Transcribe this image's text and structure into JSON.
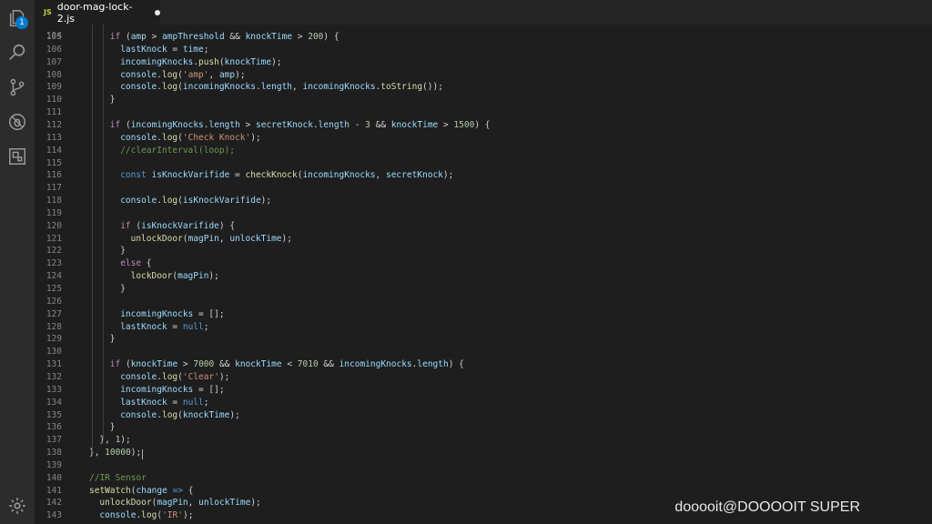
{
  "tab": {
    "icon": "JS",
    "filename": "door-mag-lock-2.js",
    "dirty": true
  },
  "activity": {
    "explorer_badge": "1"
  },
  "watermark": "dooooit@DOOOOIT SUPER",
  "code": {
    "partial_top": "104",
    "lines": [
      {
        "n": "105",
        "i": 2,
        "t": [
          [
            "cf",
            "if"
          ],
          [
            "p",
            " ("
          ],
          [
            "v",
            "amp"
          ],
          [
            "p",
            " > "
          ],
          [
            "v",
            "ampThreshold"
          ],
          [
            "p",
            " && "
          ],
          [
            "v",
            "knockTime"
          ],
          [
            "p",
            " > "
          ],
          [
            "n",
            "200"
          ],
          [
            "p",
            ") {"
          ]
        ]
      },
      {
        "n": "106",
        "i": 3,
        "t": [
          [
            "v",
            "lastKnock"
          ],
          [
            "p",
            " = "
          ],
          [
            "v",
            "time"
          ],
          [
            "p",
            ";"
          ]
        ]
      },
      {
        "n": "107",
        "i": 3,
        "t": [
          [
            "v",
            "incomingKnocks"
          ],
          [
            "p",
            "."
          ],
          [
            "f",
            "push"
          ],
          [
            "p",
            "("
          ],
          [
            "v",
            "knockTime"
          ],
          [
            "p",
            ");"
          ]
        ]
      },
      {
        "n": "108",
        "i": 3,
        "t": [
          [
            "v",
            "console"
          ],
          [
            "p",
            "."
          ],
          [
            "f",
            "log"
          ],
          [
            "p",
            "("
          ],
          [
            "s",
            "'amp'"
          ],
          [
            "p",
            ", "
          ],
          [
            "v",
            "amp"
          ],
          [
            "p",
            ");"
          ]
        ]
      },
      {
        "n": "109",
        "i": 3,
        "t": [
          [
            "v",
            "console"
          ],
          [
            "p",
            "."
          ],
          [
            "f",
            "log"
          ],
          [
            "p",
            "("
          ],
          [
            "v",
            "incomingKnocks"
          ],
          [
            "p",
            "."
          ],
          [
            "v",
            "length"
          ],
          [
            "p",
            ", "
          ],
          [
            "v",
            "incomingKnocks"
          ],
          [
            "p",
            "."
          ],
          [
            "f",
            "toString"
          ],
          [
            "p",
            "());"
          ]
        ]
      },
      {
        "n": "110",
        "i": 2,
        "t": [
          [
            "p",
            "}"
          ]
        ]
      },
      {
        "n": "111",
        "i": 0,
        "t": []
      },
      {
        "n": "112",
        "i": 2,
        "t": [
          [
            "cf",
            "if"
          ],
          [
            "p",
            " ("
          ],
          [
            "v",
            "incomingKnocks"
          ],
          [
            "p",
            "."
          ],
          [
            "v",
            "length"
          ],
          [
            "p",
            " > "
          ],
          [
            "v",
            "secretKnock"
          ],
          [
            "p",
            "."
          ],
          [
            "v",
            "length"
          ],
          [
            "p",
            " - "
          ],
          [
            "n",
            "3"
          ],
          [
            "p",
            " && "
          ],
          [
            "v",
            "knockTime"
          ],
          [
            "p",
            " > "
          ],
          [
            "n",
            "1500"
          ],
          [
            "p",
            ") {"
          ]
        ]
      },
      {
        "n": "113",
        "i": 3,
        "t": [
          [
            "v",
            "console"
          ],
          [
            "p",
            "."
          ],
          [
            "f",
            "log"
          ],
          [
            "p",
            "("
          ],
          [
            "s",
            "'Check Knock'"
          ],
          [
            "p",
            ");"
          ]
        ]
      },
      {
        "n": "114",
        "i": 3,
        "t": [
          [
            "c",
            "//clearInterval(loop);"
          ]
        ]
      },
      {
        "n": "115",
        "i": 0,
        "t": []
      },
      {
        "n": "116",
        "i": 3,
        "t": [
          [
            "k",
            "const"
          ],
          [
            "p",
            " "
          ],
          [
            "v",
            "isKnockVarifide"
          ],
          [
            "p",
            " = "
          ],
          [
            "f",
            "checkKnock"
          ],
          [
            "p",
            "("
          ],
          [
            "v",
            "incomingKnocks"
          ],
          [
            "p",
            ", "
          ],
          [
            "v",
            "secretKnock"
          ],
          [
            "p",
            ");"
          ]
        ]
      },
      {
        "n": "117",
        "i": 0,
        "t": []
      },
      {
        "n": "118",
        "i": 3,
        "t": [
          [
            "v",
            "console"
          ],
          [
            "p",
            "."
          ],
          [
            "f",
            "log"
          ],
          [
            "p",
            "("
          ],
          [
            "v",
            "isKnockVarifide"
          ],
          [
            "p",
            ");"
          ]
        ]
      },
      {
        "n": "119",
        "i": 0,
        "t": []
      },
      {
        "n": "120",
        "i": 3,
        "t": [
          [
            "cf",
            "if"
          ],
          [
            "p",
            " ("
          ],
          [
            "v",
            "isKnockVarifide"
          ],
          [
            "p",
            ") {"
          ]
        ]
      },
      {
        "n": "121",
        "i": 4,
        "t": [
          [
            "f",
            "unlockDoor"
          ],
          [
            "p",
            "("
          ],
          [
            "v",
            "magPin"
          ],
          [
            "p",
            ", "
          ],
          [
            "v",
            "unlockTime"
          ],
          [
            "p",
            ");"
          ]
        ]
      },
      {
        "n": "122",
        "i": 3,
        "t": [
          [
            "p",
            "}"
          ]
        ]
      },
      {
        "n": "123",
        "i": 3,
        "t": [
          [
            "cf",
            "else"
          ],
          [
            "p",
            " {"
          ]
        ]
      },
      {
        "n": "124",
        "i": 4,
        "t": [
          [
            "f",
            "lockDoor"
          ],
          [
            "p",
            "("
          ],
          [
            "v",
            "magPin"
          ],
          [
            "p",
            ");"
          ]
        ]
      },
      {
        "n": "125",
        "i": 3,
        "t": [
          [
            "p",
            "}"
          ]
        ]
      },
      {
        "n": "126",
        "i": 0,
        "t": []
      },
      {
        "n": "127",
        "i": 3,
        "t": [
          [
            "v",
            "incomingKnocks"
          ],
          [
            "p",
            " = [];"
          ]
        ]
      },
      {
        "n": "128",
        "i": 3,
        "t": [
          [
            "v",
            "lastKnock"
          ],
          [
            "p",
            " = "
          ],
          [
            "k",
            "null"
          ],
          [
            "p",
            ";"
          ]
        ]
      },
      {
        "n": "129",
        "i": 2,
        "t": [
          [
            "p",
            "}"
          ]
        ]
      },
      {
        "n": "130",
        "i": 0,
        "t": []
      },
      {
        "n": "131",
        "i": 2,
        "t": [
          [
            "cf",
            "if"
          ],
          [
            "p",
            " ("
          ],
          [
            "v",
            "knockTime"
          ],
          [
            "p",
            " > "
          ],
          [
            "n",
            "7000"
          ],
          [
            "p",
            " && "
          ],
          [
            "v",
            "knockTime"
          ],
          [
            "p",
            " < "
          ],
          [
            "n",
            "7010"
          ],
          [
            "p",
            " && "
          ],
          [
            "v",
            "incomingKnocks"
          ],
          [
            "p",
            "."
          ],
          [
            "v",
            "length"
          ],
          [
            "p",
            ") {"
          ]
        ]
      },
      {
        "n": "132",
        "i": 3,
        "t": [
          [
            "v",
            "console"
          ],
          [
            "p",
            "."
          ],
          [
            "f",
            "log"
          ],
          [
            "p",
            "("
          ],
          [
            "s",
            "'Clear'"
          ],
          [
            "p",
            ");"
          ]
        ]
      },
      {
        "n": "133",
        "i": 3,
        "t": [
          [
            "v",
            "incomingKnocks"
          ],
          [
            "p",
            " = [];"
          ]
        ]
      },
      {
        "n": "134",
        "i": 3,
        "t": [
          [
            "v",
            "lastKnock"
          ],
          [
            "p",
            " = "
          ],
          [
            "k",
            "null"
          ],
          [
            "p",
            ";"
          ]
        ]
      },
      {
        "n": "135",
        "i": 3,
        "t": [
          [
            "v",
            "console"
          ],
          [
            "p",
            "."
          ],
          [
            "f",
            "log"
          ],
          [
            "p",
            "("
          ],
          [
            "v",
            "knockTime"
          ],
          [
            "p",
            ");"
          ]
        ]
      },
      {
        "n": "136",
        "i": 2,
        "t": [
          [
            "p",
            "}"
          ]
        ]
      },
      {
        "n": "137",
        "i": 1,
        "t": [
          [
            "p",
            "}, "
          ],
          [
            "n",
            "1"
          ],
          [
            "p",
            ");"
          ]
        ]
      },
      {
        "n": "138",
        "i": 0,
        "t": [
          [
            "p",
            "}, "
          ],
          [
            "n",
            "10000"
          ],
          [
            "p",
            ");"
          ]
        ]
      },
      {
        "n": "139",
        "i": 0,
        "t": []
      },
      {
        "n": "140",
        "i": 0,
        "t": [
          [
            "c",
            "//IR Sensor"
          ]
        ]
      },
      {
        "n": "141",
        "i": 0,
        "t": [
          [
            "f",
            "setWatch"
          ],
          [
            "p",
            "("
          ],
          [
            "v",
            "change"
          ],
          [
            "p",
            " "
          ],
          [
            "k",
            "=>"
          ],
          [
            "p",
            " {"
          ]
        ]
      },
      {
        "n": "142",
        "i": 1,
        "t": [
          [
            "f",
            "unlockDoor"
          ],
          [
            "p",
            "("
          ],
          [
            "v",
            "magPin"
          ],
          [
            "p",
            ", "
          ],
          [
            "v",
            "unlockTime"
          ],
          [
            "p",
            ");"
          ]
        ]
      },
      {
        "n": "143",
        "i": 1,
        "t": [
          [
            "v",
            "console"
          ],
          [
            "p",
            "."
          ],
          [
            "f",
            "log"
          ],
          [
            "p",
            "("
          ],
          [
            "s",
            "'IR'"
          ],
          [
            "p",
            ");"
          ]
        ]
      }
    ]
  },
  "icons": [
    "explorer-icon",
    "search-icon",
    "source-control-icon",
    "debug-icon",
    "extensions-icon",
    "settings-gear-icon"
  ]
}
